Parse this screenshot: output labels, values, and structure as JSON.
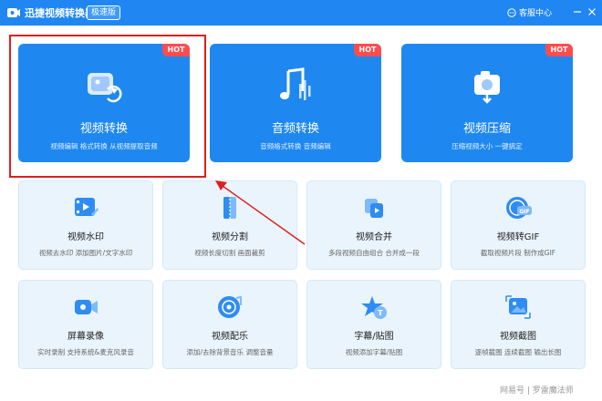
{
  "titlebar": {
    "app_title": "迅捷视频转换器",
    "edition": "极速版",
    "support": "客服中心",
    "minimize": "—",
    "close": "✕"
  },
  "main_cards": [
    {
      "title": "视频转换",
      "desc": "视频编辑 格式转换 从视频提取音频",
      "badge": "HOT"
    },
    {
      "title": "音频转换",
      "desc": "音频格式转换 音频编辑",
      "badge": "HOT"
    },
    {
      "title": "视频压缩",
      "desc": "压缩视频大小 一键搞定",
      "badge": "HOT"
    }
  ],
  "tools": [
    {
      "title": "视频水印",
      "desc": "视频去水印 添加图片/文字水印"
    },
    {
      "title": "视频分割",
      "desc": "视频长度切割 画面裁剪"
    },
    {
      "title": "视频合并",
      "desc": "多段视频自由组合 合并成一段"
    },
    {
      "title": "视频转GIF",
      "desc": "截取视频片段 制作成GIF"
    },
    {
      "title": "屏幕录像",
      "desc": "实时录制 支持系统&麦克风录音"
    },
    {
      "title": "视频配乐",
      "desc": "添加/去除背景音乐 调整音量"
    },
    {
      "title": "字幕/贴图",
      "desc": "视频添加字幕/贴图"
    },
    {
      "title": "视频截图",
      "desc": "逐帧截图 连续截图 输出长图"
    }
  ],
  "watermark": "网易号 | 罗雷魔法师",
  "icon_names": {
    "video": "video-camera-convert-icon",
    "audio": "music-note-icon",
    "compress": "compress-camera-icon",
    "watermark": "film-watermark-icon",
    "split": "split-icon",
    "merge": "merge-icon",
    "gif": "gif-icon",
    "record": "camera-record-icon",
    "music": "music-disc-icon",
    "subtitle": "star-sticker-icon",
    "screenshot": "image-crop-icon"
  },
  "colors": {
    "titlebar": "#1f86f2",
    "card_blue": "#1f88f0",
    "hot_red": "#ff4d4f",
    "tool_bg": "#eaf4fd",
    "annotation_red": "#e01e1e"
  }
}
